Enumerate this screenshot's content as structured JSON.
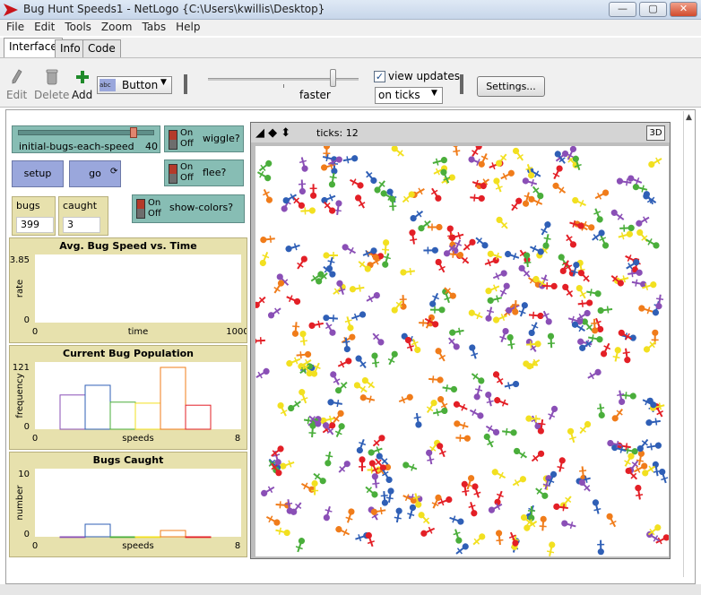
{
  "window": {
    "title": "Bug Hunt Speeds1 - NetLogo {C:\\Users\\kwillis\\Desktop}",
    "minimize": "—",
    "maximize": "▢",
    "close": "✕"
  },
  "menu": [
    "File",
    "Edit",
    "Tools",
    "Zoom",
    "Tabs",
    "Help"
  ],
  "tabs": [
    "Interface",
    "Info",
    "Code"
  ],
  "toolbar": {
    "edit": "Edit",
    "delete": "Delete",
    "add": "Add",
    "widget_type": "Button",
    "speed_label": "faster",
    "speed_level": 0.83,
    "view_updates_label": "view updates",
    "view_updates_checked": true,
    "update_mode": "on ticks",
    "settings": "Settings..."
  },
  "widgets": {
    "slider": {
      "name": "initial-bugs-each-speed",
      "value": "40",
      "fraction": 0.85
    },
    "switch_on": "On",
    "switch_off": "Off",
    "wiggle": "wiggle?",
    "flee": "flee?",
    "show_colors": "show-colors?",
    "setup": "setup",
    "go": "go",
    "bugs_label": "bugs",
    "bugs_value": "399",
    "caught_label": "caught",
    "caught_value": "3"
  },
  "view": {
    "ticks_label": "ticks: 12",
    "btn3d": "3D"
  },
  "colors": {
    "bugs": [
      "#e31f26",
      "#f07c1a",
      "#f2e020",
      "#4aae3b",
      "#2f5fb6",
      "#8a4fb6"
    ],
    "switch": "#87bdb4",
    "button": "#9aa7dc",
    "plot": "#e7e1ad"
  },
  "chart_data": [
    {
      "type": "line",
      "title": "Avg. Bug Speed vs. Time",
      "xlabel": "time",
      "ylabel": "rate",
      "xlim": [
        0,
        1000
      ],
      "ylim": [
        0,
        3.85
      ],
      "x_ticks": [
        "0",
        "1000"
      ],
      "y_ticks": [
        "0",
        "3.85"
      ],
      "series": []
    },
    {
      "type": "bar",
      "title": "Current Bug Population",
      "xlabel": "speeds",
      "ylabel": "frequency",
      "xlim": [
        0,
        8
      ],
      "ylim": [
        0,
        121
      ],
      "x_ticks": [
        "0",
        "8"
      ],
      "y_ticks": [
        "0",
        "121"
      ],
      "bins": [
        {
          "x0": 1,
          "x1": 2,
          "value": 67,
          "color": "#8a4fb6"
        },
        {
          "x0": 2,
          "x1": 3,
          "value": 86,
          "color": "#2f5fb6"
        },
        {
          "x0": 3,
          "x1": 4,
          "value": 53,
          "color": "#4aae3b"
        },
        {
          "x0": 4,
          "x1": 5,
          "value": 51,
          "color": "#f2e020"
        },
        {
          "x0": 5,
          "x1": 6,
          "value": 121,
          "color": "#f07c1a"
        },
        {
          "x0": 6,
          "x1": 7,
          "value": 47,
          "color": "#e31f26"
        }
      ]
    },
    {
      "type": "bar",
      "title": "Bugs Caught",
      "xlabel": "speeds",
      "ylabel": "number",
      "xlim": [
        0,
        8
      ],
      "ylim": [
        0,
        10
      ],
      "x_ticks": [
        "0",
        "8"
      ],
      "y_ticks": [
        "0",
        "10"
      ],
      "bins": [
        {
          "x0": 1,
          "x1": 2,
          "value": 0,
          "color": "#8a4fb6"
        },
        {
          "x0": 2,
          "x1": 3,
          "value": 2,
          "color": "#2f5fb6"
        },
        {
          "x0": 3,
          "x1": 4,
          "value": 0,
          "color": "#4aae3b"
        },
        {
          "x0": 4,
          "x1": 5,
          "value": 0,
          "color": "#f2e020"
        },
        {
          "x0": 5,
          "x1": 6,
          "value": 1,
          "color": "#f07c1a"
        },
        {
          "x0": 6,
          "x1": 7,
          "value": 0,
          "color": "#e31f26"
        }
      ]
    }
  ]
}
